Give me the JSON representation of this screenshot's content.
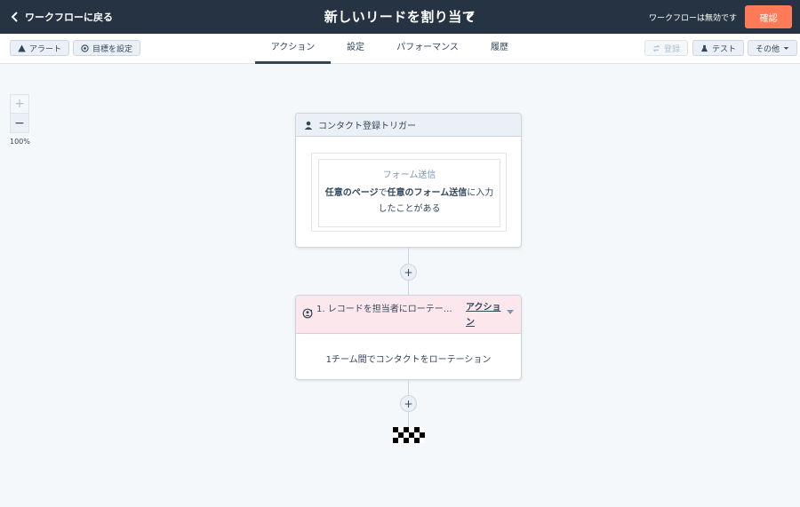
{
  "topbar": {
    "back_label": "ワークフローに戻る",
    "title": "新しいリードを割り当て",
    "status": "ワークフローは無効です",
    "confirm_label": "確認"
  },
  "toolbar": {
    "alert_label": "アラート",
    "goal_label": "目標を設定",
    "tabs": [
      "アクション",
      "設定",
      "パフォーマンス",
      "履歴"
    ],
    "active_tab": "アクション",
    "register_label": "登録",
    "test_label": "テスト",
    "more_label": "その他"
  },
  "zoom": {
    "level": "100%"
  },
  "trigger": {
    "title": "コンタクト登録トリガー",
    "filter_type": "フォーム送信",
    "desc_part1": "任意のページ",
    "desc_part2": "で",
    "desc_part3": "任意のフォーム送信",
    "desc_part4": "に入力したことがある"
  },
  "action": {
    "name": "1. レコードを担当者にローテー…",
    "menu_label": "アクション",
    "body": "1チーム間でコンタクトをローテーション"
  },
  "colors": {
    "topbar": "#253342",
    "accent": "#ff7a59",
    "action_header": "#fce8ec",
    "trigger_header": "#eaf0f6"
  }
}
